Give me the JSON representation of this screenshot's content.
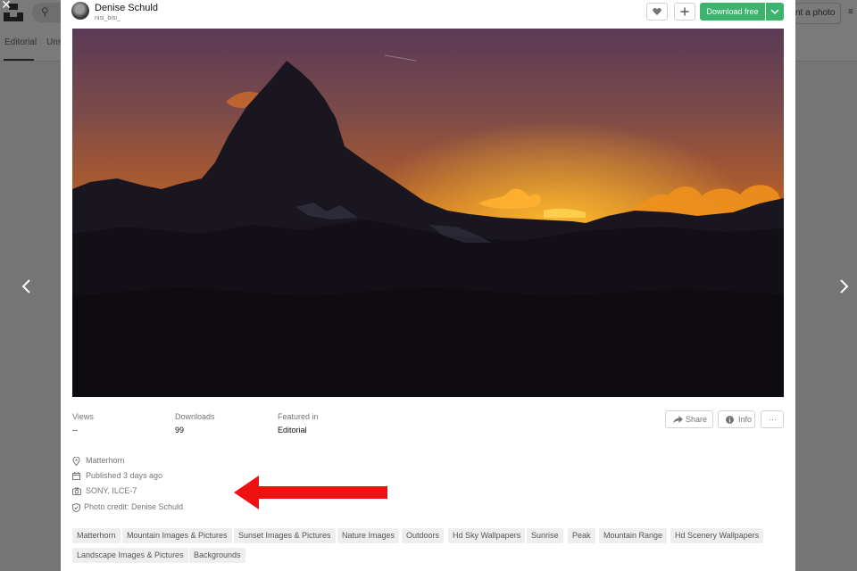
{
  "background": {
    "search_icon": "search-icon",
    "tabs": [
      "Editorial",
      "Uns"
    ],
    "submit_label": "nt a photo",
    "menu_icon": "menu-icon"
  },
  "author": {
    "name": "Denise Schuld",
    "handle": "nisi_bisi_"
  },
  "header_actions": {
    "like_icon": "heart-icon",
    "add_icon": "plus-icon",
    "download_label": "Download free",
    "caret_icon": "chevron-down-icon"
  },
  "stats": [
    {
      "label": "Views",
      "value": "--"
    },
    {
      "label": "Downloads",
      "value": "99"
    },
    {
      "label": "Featured in",
      "value": "Editorial"
    }
  ],
  "actions": {
    "share": "Share",
    "info": "Info",
    "more": "···"
  },
  "meta": {
    "location": "Matterhorn",
    "published": "Published 3 days ago",
    "camera": "SONY, ILCE-7",
    "credit": "Photo credit: Denise Schuld"
  },
  "tags": [
    "Matterhorn",
    "Mountain Images & Pictures",
    "Sunset Images & Pictures",
    "Nature Images",
    "Outdoors",
    "Hd Sky Wallpapers",
    "Sunrise",
    "Peak",
    "Mountain Range",
    "Hd Scenery Wallpapers",
    "Landscape Images & Pictures",
    "Backgrounds"
  ],
  "colors": {
    "download_green": "#3cb46e",
    "annotation_red": "#ee1111",
    "overlay_gray": "#757575"
  }
}
